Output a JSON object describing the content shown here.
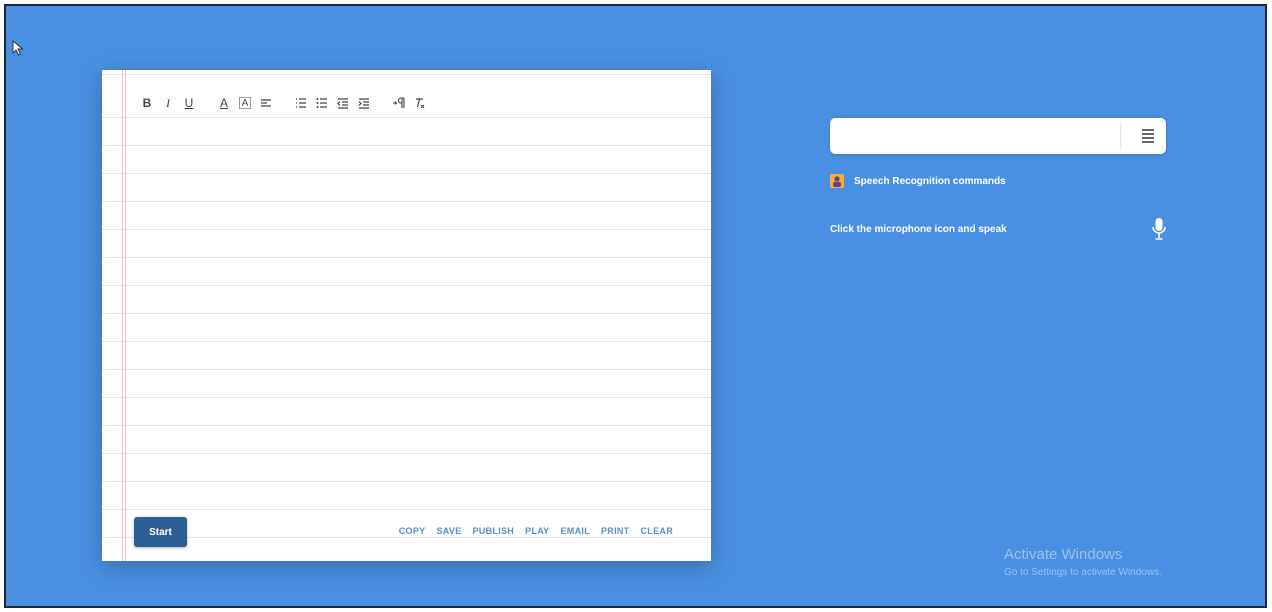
{
  "toolbar": {
    "buttons": [
      {
        "name": "bold",
        "label": "B"
      },
      {
        "name": "italic",
        "label": "I"
      },
      {
        "name": "underline",
        "label": "U"
      },
      {
        "name": "font-color",
        "label": "A"
      },
      {
        "name": "highlight",
        "label": "A"
      }
    ]
  },
  "editor": {
    "start_label": "Start",
    "actions": [
      "COPY",
      "SAVE",
      "PUBLISH",
      "PLAY",
      "EMAIL",
      "PRINT",
      "CLEAR"
    ]
  },
  "panel": {
    "search_value": "",
    "commands_label": "Speech Recognition commands",
    "mic_hint": "Click the microphone icon and speak"
  },
  "watermark": {
    "title": "Activate Windows",
    "subtitle": "Go to Settings to activate Windows."
  },
  "colors": {
    "background": "#4a90e2",
    "start_button": "#2c5f93",
    "action_link": "#5b8fc9"
  }
}
